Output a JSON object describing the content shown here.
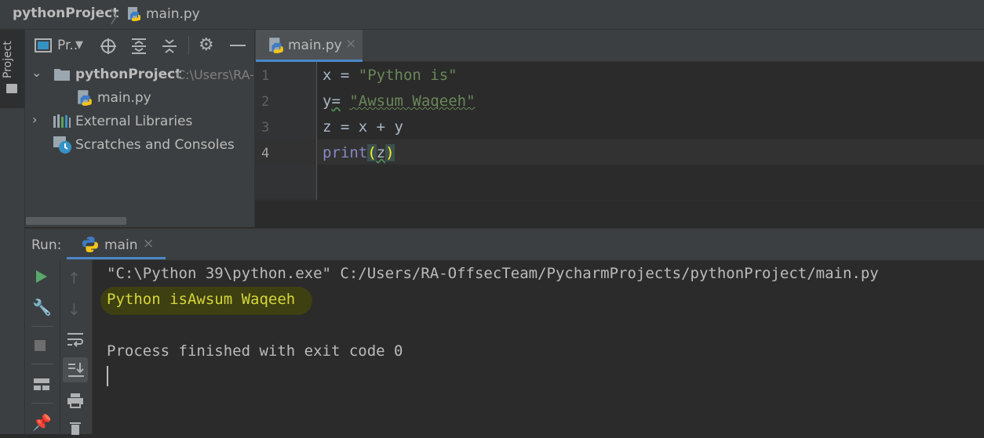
{
  "breadcrumb": {
    "project": "pythonProject",
    "file": "main.py"
  },
  "left_strip": {
    "project_tab": "Project"
  },
  "project_panel": {
    "view_label": "Pr..",
    "tree": [
      {
        "label": "pythonProject",
        "path": "C:\\Users\\RA-",
        "icon": "folder-icon"
      },
      {
        "label": "main.py",
        "icon": "python-file-icon"
      },
      {
        "label": "External Libraries",
        "icon": "libraries-icon"
      },
      {
        "label": "Scratches and Consoles",
        "icon": "scratches-icon"
      }
    ]
  },
  "editor": {
    "tab": {
      "label": "main.py",
      "close": "×"
    },
    "line_numbers": [
      "1",
      "2",
      "3",
      "4"
    ],
    "code": {
      "l1_a": "x = ",
      "l1_str": "\"Python is\"",
      "l2_a": "y",
      "l2_b": "=",
      "l2_sp": " ",
      "l2_str": "\"Awsum Waqeeh\"",
      "l3": "z = x + y",
      "l4_fn": "print",
      "l4_open": "(",
      "l4_arg": "z",
      "l4_close": ")"
    }
  },
  "run": {
    "label": "Run:",
    "tab": {
      "label": "main",
      "close": "×"
    },
    "console": [
      "\"C:\\Python 39\\python.exe\" C:/Users/RA-OffsecTeam/PycharmProjects/pythonProject/main.py",
      "Python isAwsum Waqeeh",
      "",
      "Process finished with exit code 0"
    ]
  },
  "colors": {
    "accent": "#4a88c7",
    "string": "#6a8759",
    "builtin": "#8888c6",
    "brace": "#ffef28"
  }
}
